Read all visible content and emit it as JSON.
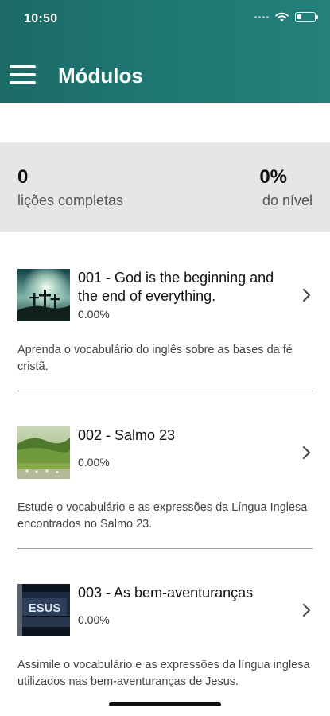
{
  "status_bar": {
    "time": "10:50",
    "icons": [
      "signal-dots-icon",
      "wifi-icon",
      "battery-icon"
    ]
  },
  "header": {
    "title": "Módulos",
    "menu_icon": "hamburger-menu-icon",
    "background_color": "#1f7873"
  },
  "stats": {
    "completed_value": "0",
    "completed_label": "lições completas",
    "level_value": "0%",
    "level_label": "do nível",
    "background_color": "#e6e6e6"
  },
  "modules": [
    {
      "title": "001 - God is the beginning and the end of everything.",
      "progress_text": "0.00%",
      "progress": 0,
      "description": "Aprenda o vocabulário do inglês sobre as bases da fé cristã.",
      "thumbnail": "crosses-at-sunset-image"
    },
    {
      "title": "002 - Salmo 23",
      "progress_text": "0.00%",
      "progress": 0,
      "description": "Estude o vocabulário e as expressões da Língua Inglesa encontrados no Salmo 23.",
      "thumbnail": "green-pasture-image"
    },
    {
      "title": "003 - As bem-aventuranças",
      "progress_text": "0.00%",
      "progress": 0,
      "description": "Assimile o vocabulário e as expressões da língua inglesa utilizados nas bem-aventuranças de Jesus.",
      "thumbnail": "jesus-lettering-image"
    }
  ]
}
